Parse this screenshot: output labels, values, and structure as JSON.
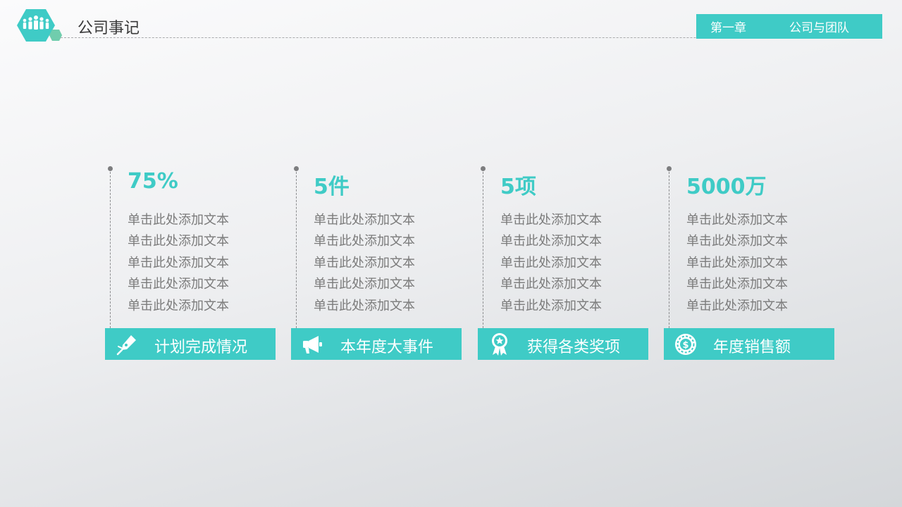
{
  "header": {
    "title": "公司事记",
    "chapter_number": "第一章",
    "chapter_name": "公司与团队"
  },
  "colors": {
    "accent": "#3fcbc6",
    "accent_secondary": "#7ed27e",
    "text_body": "#7b7b7b",
    "text_title": "#3a3a3a"
  },
  "columns": [
    {
      "stat": "75%",
      "lines": [
        "单击此处添加文本",
        "单击此处添加文本",
        "单击此处添加文本",
        "单击此处添加文本",
        "单击此处添加文本"
      ],
      "label": "计划完成情况",
      "icon": "pen-nib-icon"
    },
    {
      "stat": "5件",
      "lines": [
        "单击此处添加文本",
        "单击此处添加文本",
        "单击此处添加文本",
        "单击此处添加文本",
        "单击此处添加文本"
      ],
      "label": "本年度大事件",
      "icon": "megaphone-icon"
    },
    {
      "stat": "5项",
      "lines": [
        "单击此处添加文本",
        "单击此处添加文本",
        "单击此处添加文本",
        "单击此处添加文本",
        "单击此处添加文本"
      ],
      "label": "获得各类奖项",
      "icon": "award-medal-icon"
    },
    {
      "stat": "5000万",
      "lines": [
        "单击此处添加文本",
        "单击此处添加文本",
        "单击此处添加文本",
        "单击此处添加文本",
        "单击此处添加文本"
      ],
      "label": "年度销售额",
      "icon": "dollar-coin-icon"
    }
  ]
}
